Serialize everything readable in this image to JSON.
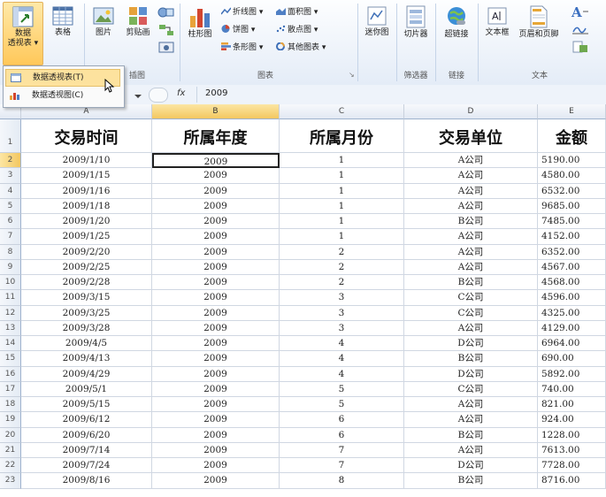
{
  "ribbon": {
    "pivot_btn": {
      "line1": "数据",
      "line2": "透视表 ▾"
    },
    "table": "表格",
    "picture": "图片",
    "clipart": "剪贴画",
    "group_illustrations": "插图",
    "column_chart": "柱形图",
    "line_chart": "折线图 ▾",
    "pie_chart": "饼图 ▾",
    "bar_chart": "条形图 ▾",
    "area_chart": "面积图 ▾",
    "scatter_chart": "散点图 ▾",
    "other_charts": "其他图表 ▾",
    "group_charts": "图表",
    "sparkline": "迷你图",
    "slicer": "切片器",
    "hyperlink": "超链接",
    "textbox": "文本框",
    "header_footer": "页眉和页脚",
    "group_filter": "筛选器",
    "group_links": "链接",
    "group_text": "文本"
  },
  "dropdown": {
    "items": [
      "数据透视表(T)",
      "数据透视图(C)"
    ]
  },
  "formula_bar": {
    "fx": "fx",
    "value": "2009"
  },
  "columns": [
    "A",
    "B",
    "C",
    "D",
    "E"
  ],
  "headers": [
    "交易时间",
    "所属年度",
    "所属月份",
    "交易单位",
    "金额"
  ],
  "rows": [
    {
      "n": "2",
      "cells": [
        "2009/1/10",
        "2009",
        "1",
        "A公司",
        "5190.00"
      ]
    },
    {
      "n": "3",
      "cells": [
        "2009/1/15",
        "2009",
        "1",
        "A公司",
        "4580.00"
      ]
    },
    {
      "n": "4",
      "cells": [
        "2009/1/16",
        "2009",
        "1",
        "A公司",
        "6532.00"
      ]
    },
    {
      "n": "5",
      "cells": [
        "2009/1/18",
        "2009",
        "1",
        "A公司",
        "9685.00"
      ]
    },
    {
      "n": "6",
      "cells": [
        "2009/1/20",
        "2009",
        "1",
        "B公司",
        "7485.00"
      ]
    },
    {
      "n": "7",
      "cells": [
        "2009/1/25",
        "2009",
        "1",
        "A公司",
        "4152.00"
      ]
    },
    {
      "n": "8",
      "cells": [
        "2009/2/20",
        "2009",
        "2",
        "A公司",
        "6352.00"
      ]
    },
    {
      "n": "9",
      "cells": [
        "2009/2/25",
        "2009",
        "2",
        "A公司",
        "4567.00"
      ]
    },
    {
      "n": "10",
      "cells": [
        "2009/2/28",
        "2009",
        "2",
        "B公司",
        "4568.00"
      ]
    },
    {
      "n": "11",
      "cells": [
        "2009/3/15",
        "2009",
        "3",
        "C公司",
        "4596.00"
      ]
    },
    {
      "n": "12",
      "cells": [
        "2009/3/25",
        "2009",
        "3",
        "C公司",
        "4325.00"
      ]
    },
    {
      "n": "13",
      "cells": [
        "2009/3/28",
        "2009",
        "3",
        "A公司",
        "4129.00"
      ]
    },
    {
      "n": "14",
      "cells": [
        "2009/4/5",
        "2009",
        "4",
        "D公司",
        "6964.00"
      ]
    },
    {
      "n": "15",
      "cells": [
        "2009/4/13",
        "2009",
        "4",
        "B公司",
        "690.00"
      ]
    },
    {
      "n": "16",
      "cells": [
        "2009/4/29",
        "2009",
        "4",
        "D公司",
        "5892.00"
      ]
    },
    {
      "n": "17",
      "cells": [
        "2009/5/1",
        "2009",
        "5",
        "C公司",
        "740.00"
      ]
    },
    {
      "n": "18",
      "cells": [
        "2009/5/15",
        "2009",
        "5",
        "A公司",
        "821.00"
      ]
    },
    {
      "n": "19",
      "cells": [
        "2009/6/12",
        "2009",
        "6",
        "A公司",
        "924.00"
      ]
    },
    {
      "n": "20",
      "cells": [
        "2009/6/20",
        "2009",
        "6",
        "B公司",
        "1228.00"
      ]
    },
    {
      "n": "21",
      "cells": [
        "2009/7/14",
        "2009",
        "7",
        "A公司",
        "7613.00"
      ]
    },
    {
      "n": "22",
      "cells": [
        "2009/7/24",
        "2009",
        "7",
        "D公司",
        "7728.00"
      ]
    },
    {
      "n": "23",
      "cells": [
        "2009/8/16",
        "2009",
        "8",
        "B公司",
        "8716.00"
      ]
    }
  ]
}
